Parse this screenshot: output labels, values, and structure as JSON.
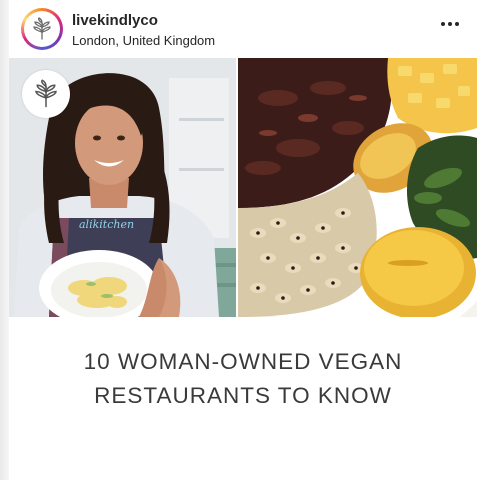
{
  "post": {
    "username": "livekindlyco",
    "location": "London, United Kingdom",
    "more_icon": "more-horizontal-icon",
    "avatar_icon": "plant-sprout-icon"
  },
  "image": {
    "left_photo": "woman-holding-plate-of-pasta",
    "right_photo": "vegan-plate-jackfruit-beans-plantain-greens",
    "apron_text": "alikitchen"
  },
  "caption": {
    "line1": "10 WOMAN-OWNED VEGAN",
    "line2": "RESTAURANTS TO KNOW"
  },
  "colors": {
    "text": "#262626",
    "headline": "#3a3a3a",
    "ring_gradient": [
      "#f58529",
      "#dd2a7b",
      "#8134af",
      "#515bd4"
    ]
  }
}
